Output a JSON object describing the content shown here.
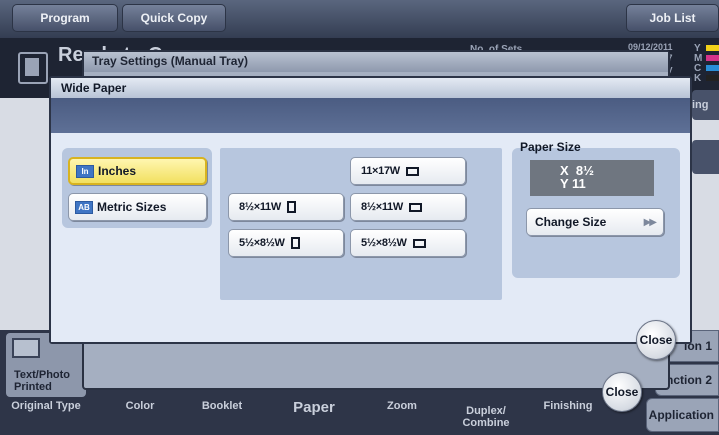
{
  "topbar": {
    "program_label": "Program",
    "quick_copy_label": "Quick Copy",
    "job_list_label": "Job List"
  },
  "background": {
    "title": "Ready to Copy",
    "no_of_sets_label": "No. of Sets",
    "datetime": "09/12/2011\n13:47\nmory",
    "toner": "Y\nM\nC\nK",
    "toner_colors": [
      "#f2d21a",
      "#d6348a",
      "#2a8fd8",
      "#222222"
    ],
    "side_label": "ing"
  },
  "bottom": {
    "text_photo_label": "Text/Photo\nPrinted",
    "tabs": [
      "Original Type",
      "Color",
      "Booklet",
      "Paper",
      "Zoom",
      "Duplex/\nCombine",
      "Finishing"
    ],
    "application_label": "Application",
    "function1_label": "ion 1",
    "function2_label": "unction 2"
  },
  "back_dialog": {
    "title": "Tray Settings (Manual Tray)",
    "close_label": "Close"
  },
  "dialog": {
    "title": "Wide Paper",
    "close_label": "Close",
    "units": [
      {
        "label": "Inches",
        "badge": "In",
        "selected": true
      },
      {
        "label": "Metric Sizes",
        "badge": "AB",
        "selected": false
      }
    ],
    "sizes": [
      {
        "label": "11×17W",
        "orientation": "landscape"
      },
      {
        "label": "8½×11W",
        "orientation": "portrait"
      },
      {
        "label": "8½×11W",
        "orientation": "landscape"
      },
      {
        "label": "5½×8½W",
        "orientation": "portrait"
      },
      {
        "label": "5½×8½W",
        "orientation": "landscape"
      }
    ],
    "paper_size": {
      "label": "Paper Size",
      "value": "X  8½\nY 11",
      "change_label": "Change Size"
    }
  }
}
